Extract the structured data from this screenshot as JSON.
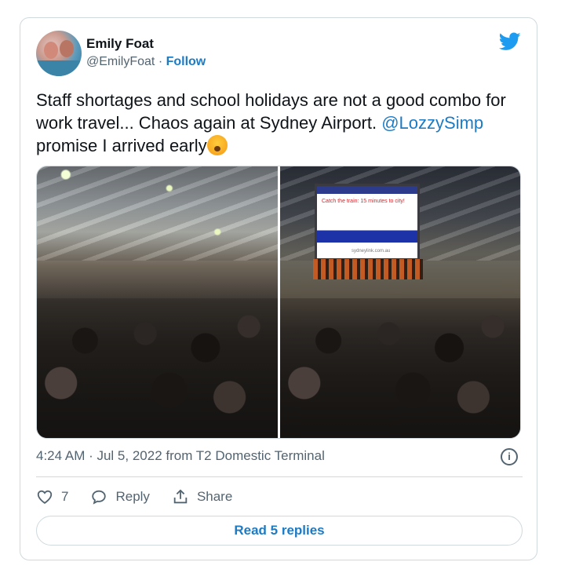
{
  "author": {
    "name": "Emily Foat",
    "handle": "@EmilyFoat",
    "separator": " · ",
    "follow_label": "Follow"
  },
  "tweet": {
    "text_before": "Staff shortages and school holidays are not a good combo for work travel... Chaos again at Sydney Airport. ",
    "mention": "@LozzySimp",
    "text_after": " promise I arrived early"
  },
  "media": {
    "right_photo_screen_text": "Catch the train: 15 minutes to city!",
    "right_photo_screen_url": "sydneylink.com.au"
  },
  "meta": {
    "timestamp": "4:24 AM · Jul 5, 2022 from T2 Domestic Terminal"
  },
  "actions": {
    "like_count": "7",
    "reply_label": "Reply",
    "share_label": "Share"
  },
  "footer": {
    "read_replies_label": "Read 5 replies"
  },
  "colors": {
    "accent": "#1d7bc4",
    "twitter_blue": "#1d9bf0",
    "muted_text": "#536471",
    "border": "#cfd9de"
  },
  "icons": [
    "avatar",
    "twitter-bird-icon",
    "info-icon",
    "heart-icon",
    "reply-bubble-icon",
    "share-icon",
    "emoji-yawning-face-icon"
  ]
}
